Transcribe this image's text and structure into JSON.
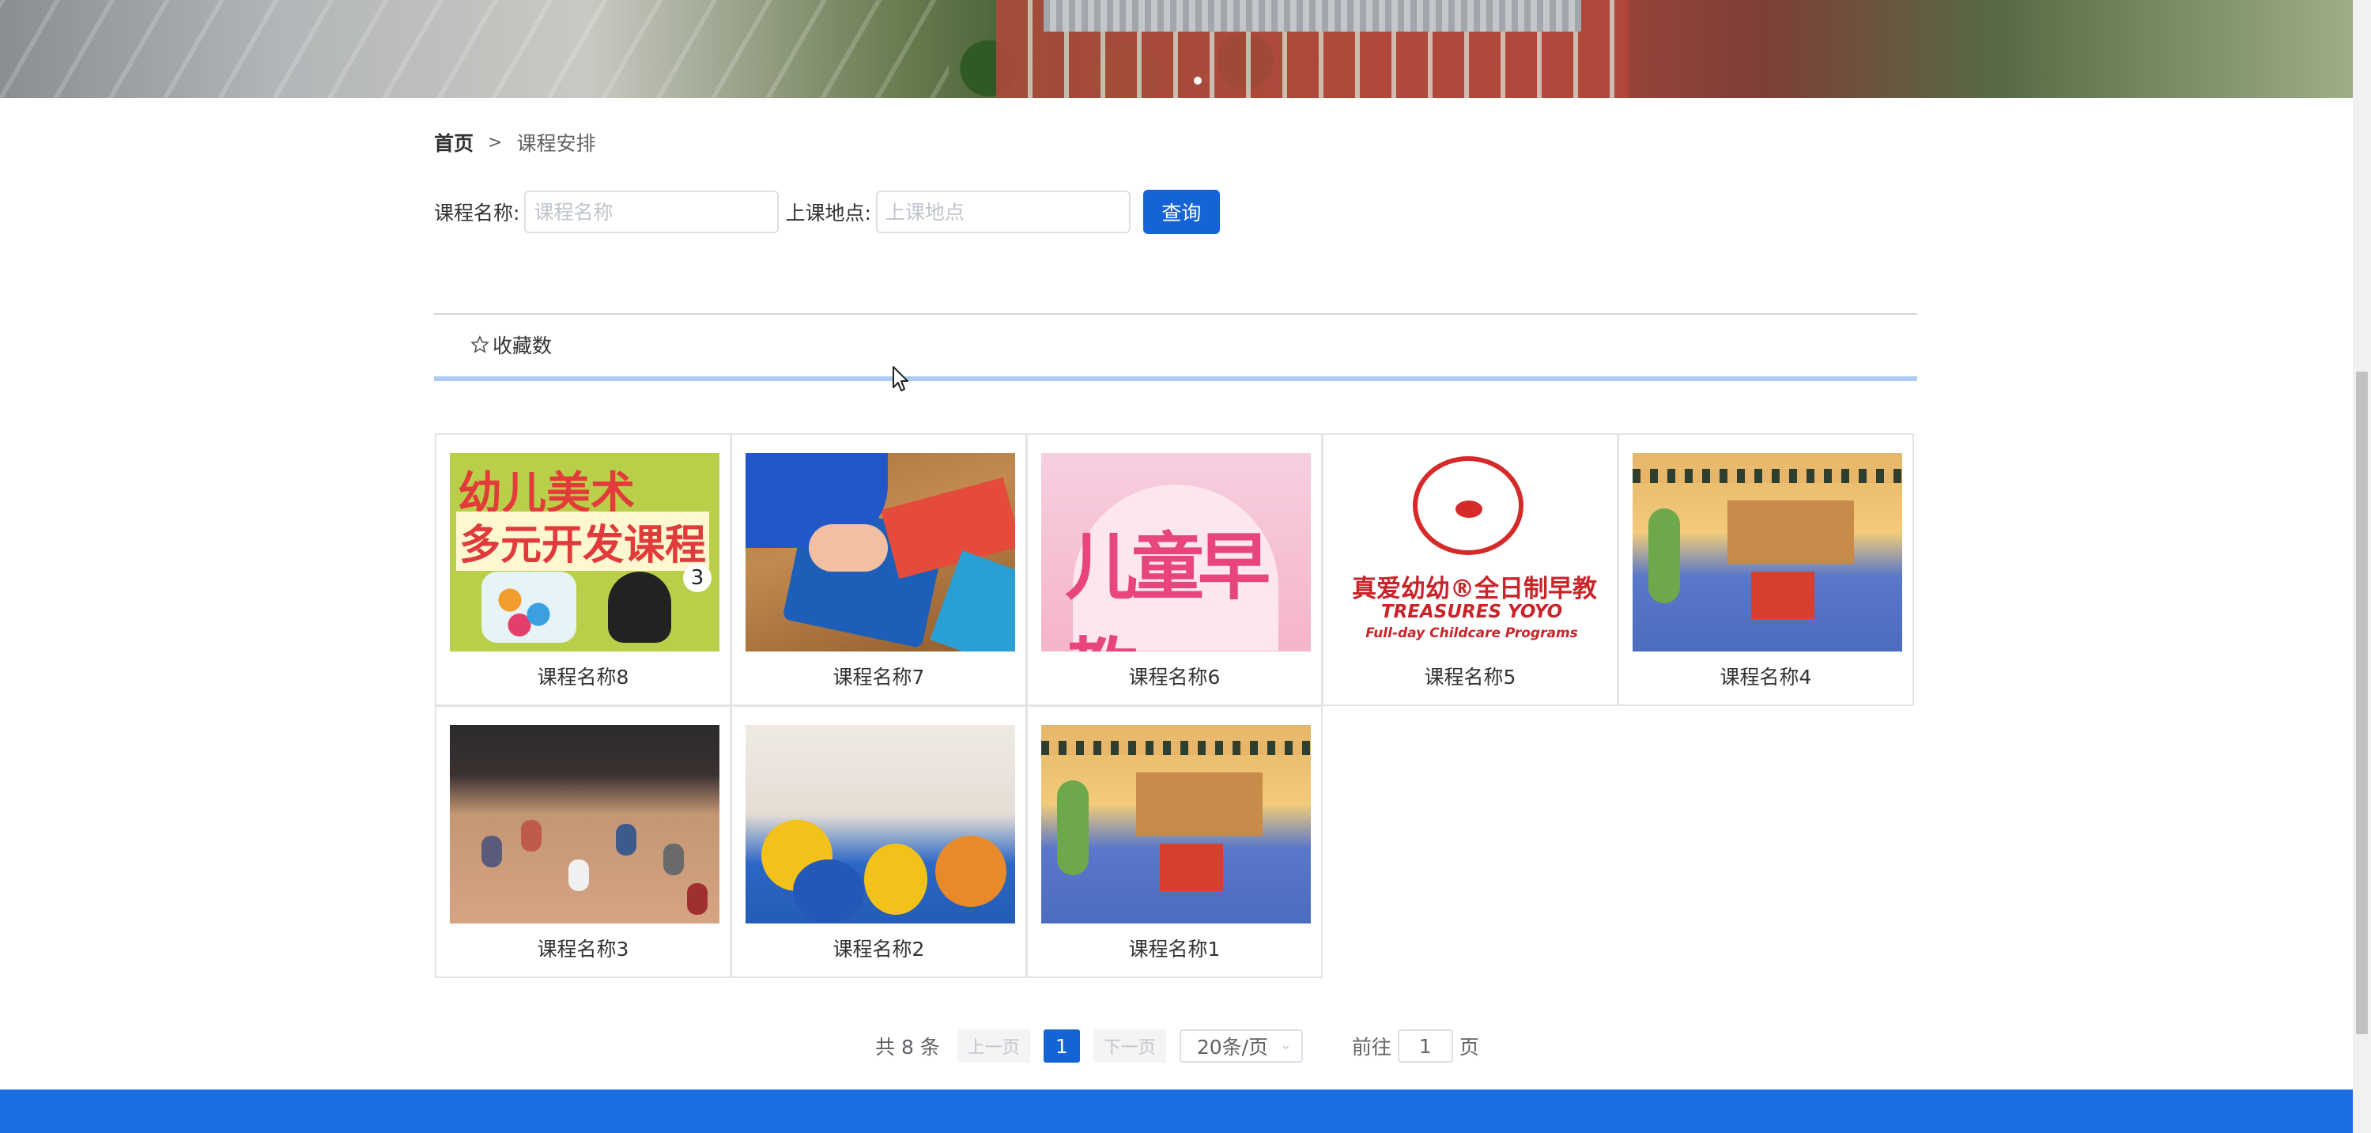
{
  "breadcrumb": {
    "home": "首页",
    "separator": ">",
    "current": "课程安排"
  },
  "search": {
    "course_name_label": "课程名称:",
    "course_name_placeholder": "课程名称",
    "location_label": "上课地点:",
    "location_placeholder": "上课地点",
    "query_button": "查询"
  },
  "sort": {
    "favorites_label": "收藏数",
    "icon": "star-outline-icon"
  },
  "courses": [
    {
      "name": "课程名称8",
      "image_text": [
        "幼儿美术",
        "多元开发课程",
        "3"
      ]
    },
    {
      "name": "课程名称7"
    },
    {
      "name": "课程名称6",
      "image_text": [
        "儿童早教"
      ]
    },
    {
      "name": "课程名称5",
      "image_text": [
        "真爱幼幼®全日制早教",
        "TREASURES YOYO",
        "Full-day Childcare Programs"
      ]
    },
    {
      "name": "课程名称4"
    },
    {
      "name": "课程名称3"
    },
    {
      "name": "课程名称2"
    },
    {
      "name": "课程名称1"
    }
  ],
  "pagination": {
    "total": "共 8 条",
    "prev": "上一页",
    "current_page": "1",
    "next": "下一页",
    "page_size": "20条/页",
    "goto_prefix": "前往",
    "goto_value": "1",
    "goto_suffix": "页"
  },
  "colors": {
    "primary": "#1464d6",
    "footer": "#1a6ee3",
    "sort_underline": "#aecbf2"
  }
}
